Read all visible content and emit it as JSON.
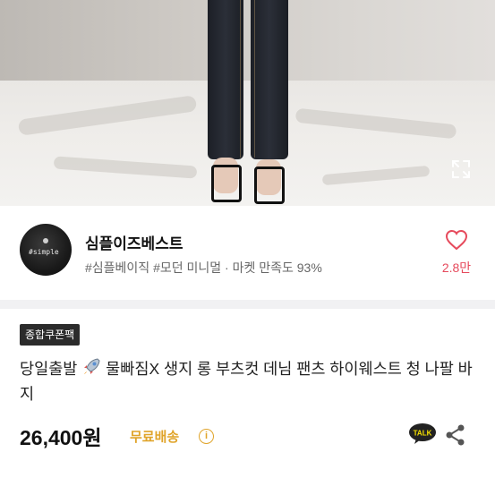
{
  "store": {
    "name": "심플이즈베스트",
    "tags": "#심플베이직 #모던 미니멀 · 마켓 만족도 93%",
    "likes": "2.8만",
    "avatar_text": "#simple"
  },
  "product": {
    "badge": "종합쿠폰팩",
    "title_prefix": "당일출발",
    "title_rest": " 물빠짐X 생지 롱 부츠컷 데님 팬츠 하이웨스트 청 나팔 바지",
    "price": "26,400원",
    "shipping": "무료배송",
    "info_glyph": "i"
  },
  "icons": {
    "expand": "expand-icon",
    "heart": "heart-icon",
    "rocket": "rocket-icon",
    "talk": "kakaotalk-icon",
    "share": "share-icon"
  },
  "colors": {
    "accent_pink": "#e64a5c",
    "shipping_gold": "#e0a42a",
    "badge_bg": "#2b2b2b",
    "talk_yellow_bg": "#222222"
  }
}
